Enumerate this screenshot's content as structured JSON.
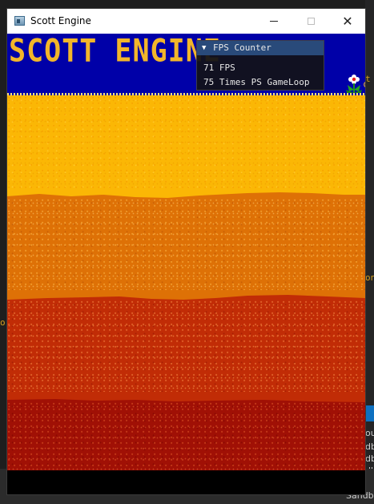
{
  "window": {
    "title": "Scott Engine",
    "close_glyph": "✕"
  },
  "game": {
    "logo_text": "SCOTT ENGINE",
    "edge_text": "c"
  },
  "fps_counter": {
    "title": "FPS Counter",
    "toggle_icon": "▼",
    "fps_text": "71 FPS",
    "gameloop_text": "75 Times PS GameLoop"
  },
  "desktop": {
    "bottom_item": "Sandb",
    "side_text_1": "t",
    "side_text_2": "on",
    "left_text": "o",
    "list_items": [
      "ou",
      "db",
      "db",
      "db",
      "db"
    ]
  },
  "colors": {
    "sky": "#0000a8",
    "logo": "#f2b62a",
    "yellow_band": "#fbb705",
    "orange_band": "#de7106",
    "red_band": "#c12c06",
    "darkred_band": "#a01005",
    "panel_header": "#294a7a"
  }
}
